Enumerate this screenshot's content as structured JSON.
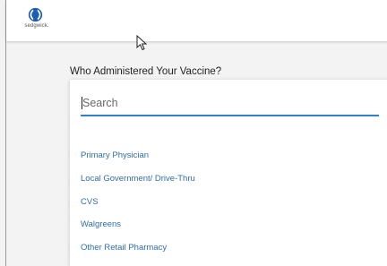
{
  "header": {
    "logo_text": "sedgwick.",
    "brand_color": "#1a5fb4"
  },
  "form": {
    "question": "Who Administered Your Vaccine?",
    "search_placeholder": "Search",
    "search_value": "",
    "options": [
      "Primary Physician",
      "Local Government/ Drive-Thru",
      "CVS",
      "Walgreens",
      "Other Retail Pharmacy"
    ],
    "accent_color": "#2f80d0"
  }
}
